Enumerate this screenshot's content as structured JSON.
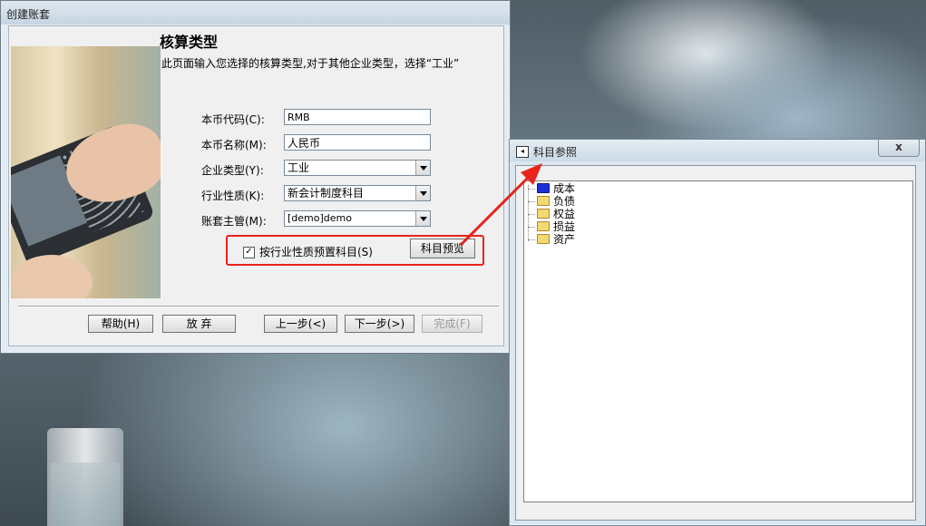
{
  "main_dialog": {
    "title": "创建账套",
    "page_title": "核算类型",
    "page_desc": "此页面输入您选择的核算类型,对于其他企业类型，选择“工业”",
    "fields": [
      {
        "label": "本币代码(C):",
        "value": "RMB",
        "kind": "text"
      },
      {
        "label": "本币名称(M):",
        "value": "人民币",
        "kind": "text"
      },
      {
        "label": "企业类型(Y):",
        "value": "工业",
        "kind": "select"
      },
      {
        "label": "行业性质(K):",
        "value": "新会计制度科目",
        "kind": "select"
      },
      {
        "label": "账套主管(M):",
        "value": "[demo]demo",
        "kind": "select"
      }
    ],
    "checkbox": {
      "label": "按行业性质预置科目(S)",
      "checked": true,
      "mark": "✓"
    },
    "preview_button": "科目预览",
    "buttons": {
      "help": "帮助(H)",
      "abandon": "放 弃",
      "prev": "上一步(<)",
      "next": "下一步(>)",
      "finish": "完成(F)"
    }
  },
  "reference_window": {
    "title": "科目参照",
    "close": "x",
    "tree": [
      {
        "label": "成本",
        "icon": "folder-blue-icon"
      },
      {
        "label": "负债",
        "icon": "folder-icon"
      },
      {
        "label": "权益",
        "icon": "folder-icon"
      },
      {
        "label": "损益",
        "icon": "folder-icon"
      },
      {
        "label": "资产",
        "icon": "folder-icon"
      }
    ]
  },
  "colors": {
    "highlight": "#e8231b",
    "arrow": "#e8231b"
  }
}
